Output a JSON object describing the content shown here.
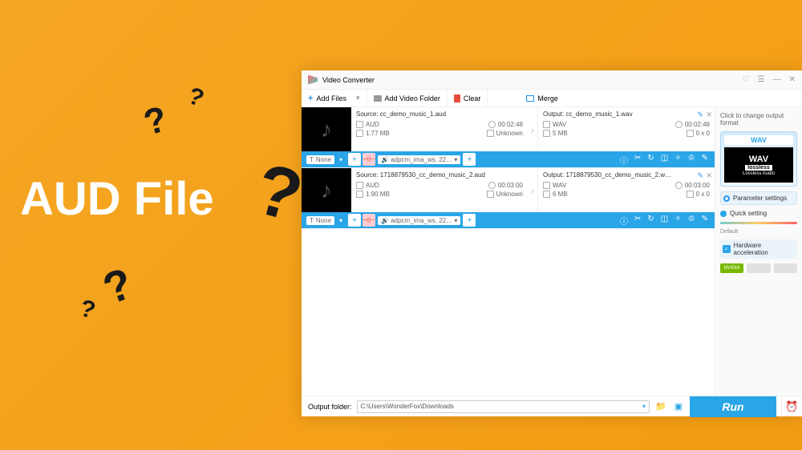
{
  "backdrop": {
    "text": "AUD File"
  },
  "window": {
    "title": "Video Converter"
  },
  "toolbar": {
    "addFiles": "Add Files",
    "addFolder": "Add Video Folder",
    "clear": "Clear",
    "merge": "Merge"
  },
  "files": [
    {
      "sourceLabel": "Source: cc_demo_music_1.aud",
      "outputLabel": "Output: cc_demo_music_1.wav",
      "src": {
        "format": "AUD",
        "duration": "00:02:48",
        "size": "1.77 MB",
        "res": "Unknown"
      },
      "out": {
        "format": "WAV",
        "duration": "00:02:48",
        "size": "5 MB",
        "res": "0 x 0"
      },
      "subtitle": "None",
      "codec": "adpcm_ima_ws, 22…"
    },
    {
      "sourceLabel": "Source: 1718879530_cc_demo_music_2.aud",
      "outputLabel": "Output: 1718879530_cc_demo_music_2.w…",
      "src": {
        "format": "AUD",
        "duration": "00:03:00",
        "size": "1.90 MB",
        "res": "Unknown"
      },
      "out": {
        "format": "WAV",
        "duration": "00:03:00",
        "size": "6 MB",
        "res": "0 x 0"
      },
      "subtitle": "None",
      "codec": "adpcm_ima_ws, 22…"
    }
  ],
  "side": {
    "hint": "Click to change output format",
    "format": "WAV",
    "wav": "WAV",
    "lossless": "lossless",
    "sublabel": "Lossless Audio",
    "param": "Parameter settings",
    "quick": "Quick setting",
    "default": "Default",
    "hw": "Hardware acceleration",
    "nvidia": "NVIDIA"
  },
  "footer": {
    "label": "Output folder:",
    "path": "C:\\Users\\WonderFox\\Downloads",
    "run": "Run"
  }
}
